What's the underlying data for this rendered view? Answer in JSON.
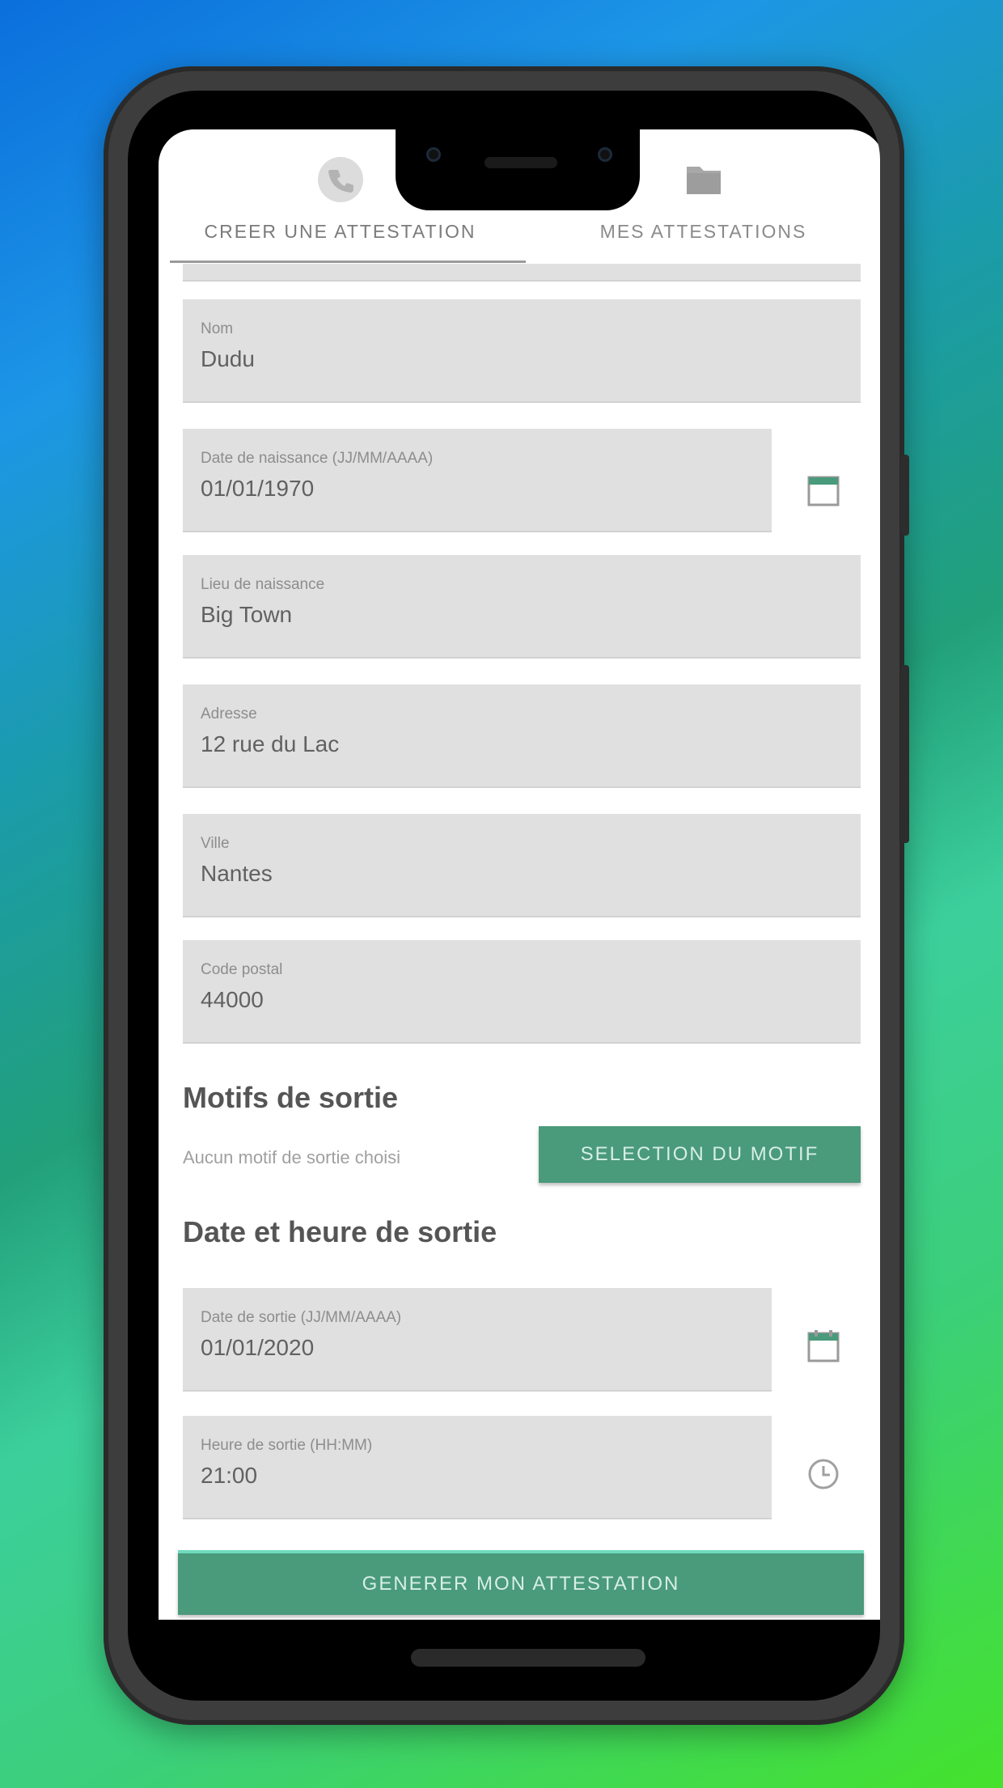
{
  "tabs": [
    {
      "label": "CREER UNE ATTESTATION",
      "icon": "phone-icon",
      "active": true
    },
    {
      "label": "MES ATTESTATIONS",
      "icon": "folder-icon",
      "active": false
    }
  ],
  "form": {
    "nom": {
      "label": "Nom",
      "value": "Dudu"
    },
    "date_naissance": {
      "label": "Date de naissance (JJ/MM/AAAA)",
      "value": "01/01/1970"
    },
    "lieu_naissance": {
      "label": "Lieu de naissance",
      "value": "Big Town"
    },
    "adresse": {
      "label": "Adresse",
      "value": "12 rue du Lac"
    },
    "ville": {
      "label": "Ville",
      "value": "Nantes"
    },
    "code_postal": {
      "label": "Code postal",
      "value": "44000"
    }
  },
  "motifs": {
    "title": "Motifs de sortie",
    "hint": "Aucun motif de sortie choisi",
    "button": "SELECTION DU MOTIF"
  },
  "sortie": {
    "title": "Date et heure de sortie",
    "date": {
      "label": "Date de sortie (JJ/MM/AAAA)",
      "value": "01/01/2020"
    },
    "heure": {
      "label": "Heure de sortie (HH:MM)",
      "value": "21:00"
    }
  },
  "generate_button": "GENERER MON ATTESTATION",
  "colors": {
    "accent": "#4a9a7c",
    "field_bg": "#e0e0e0"
  }
}
